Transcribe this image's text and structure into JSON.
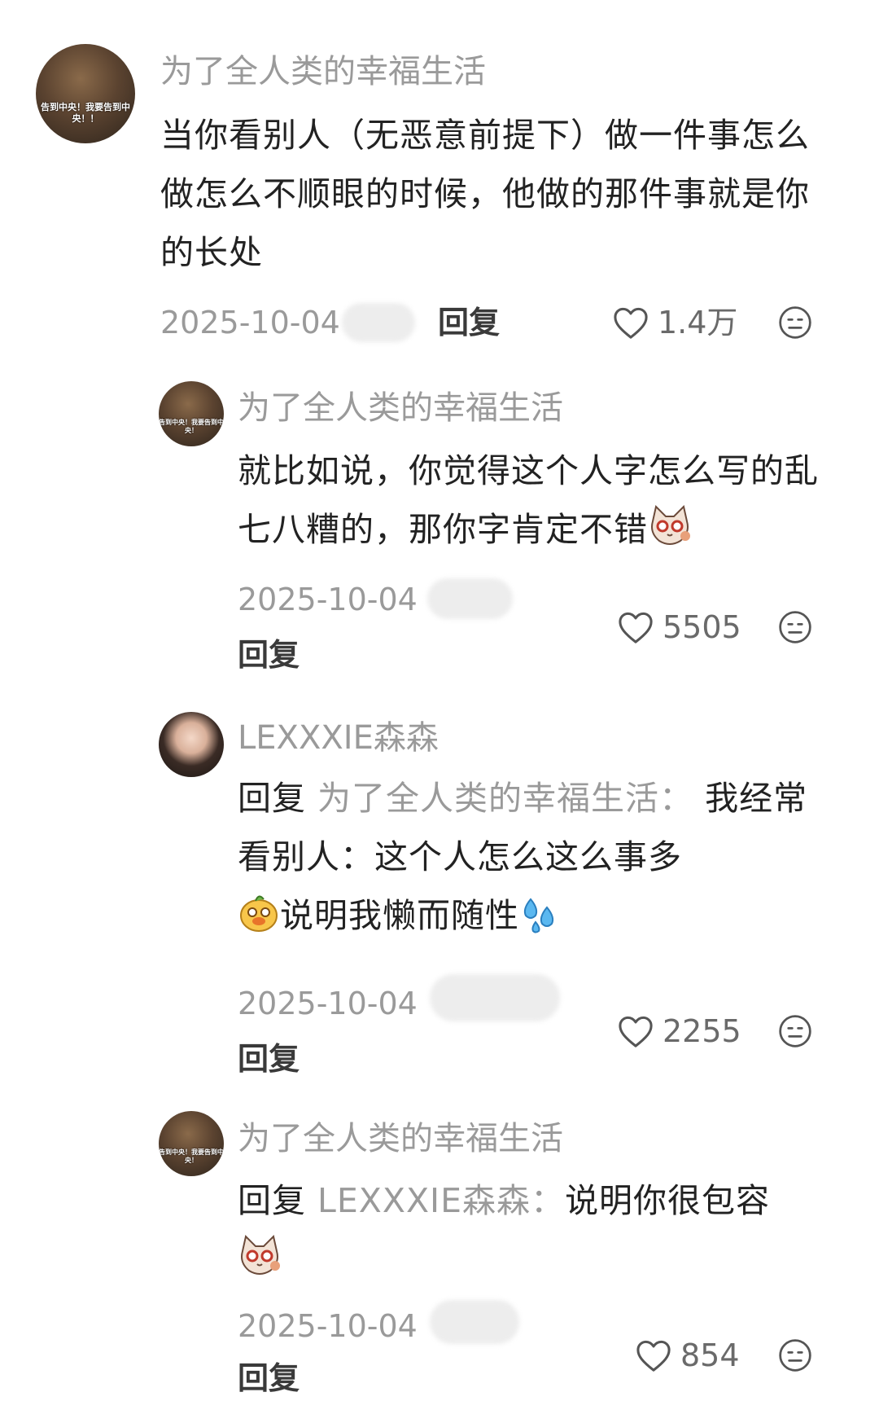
{
  "comments": [
    {
      "avatar_caption": "告到中央！我要告到中央！！",
      "name": "为了全人类的幸福生活",
      "text": "当你看别人（无恶意前提下）做一件事怎么做怎么不顺眼的时候，他做的那件事就是你的长处",
      "date": "2025-10-04",
      "reply_label": "回复",
      "likes": "1.4万"
    },
    {
      "avatar_caption": "告到中央！我要告到中央！",
      "name": "为了全人类的幸福生活",
      "text": "就比如说，你觉得这个人字怎么写的乱七八糟的，那你字肯定不错",
      "date": "2025-10-04",
      "reply_label": "回复",
      "likes": "5505"
    },
    {
      "name": "LEXXXIE森森",
      "reply_prefix": "回复",
      "reply_target": "为了全人类的幸福生活：",
      "text_a": "我经常看别人：这个人怎么这么事多",
      "text_b": "说明我懒而随性",
      "date": "2025-10-04",
      "reply_label": "回复",
      "likes": "2255"
    },
    {
      "avatar_caption": "告到中央！我要告到中央！",
      "name": "为了全人类的幸福生活",
      "reply_prefix": "回复",
      "reply_target": "LEXXXIE森森：",
      "text": "说明你很包容",
      "date": "2025-10-04",
      "reply_label": "回复",
      "likes": "854"
    }
  ],
  "icons": {
    "like": "heart-outline-icon",
    "dislike": "meh-face-icon",
    "emoji_cat": "cat-emoji-icon",
    "emoji_duck": "duck-emoji-icon",
    "emoji_sweat": "sweat-drops-emoji-icon"
  },
  "colors": {
    "name": "#9a9a9a",
    "text": "#222222",
    "meta": "#9a9a9a"
  }
}
